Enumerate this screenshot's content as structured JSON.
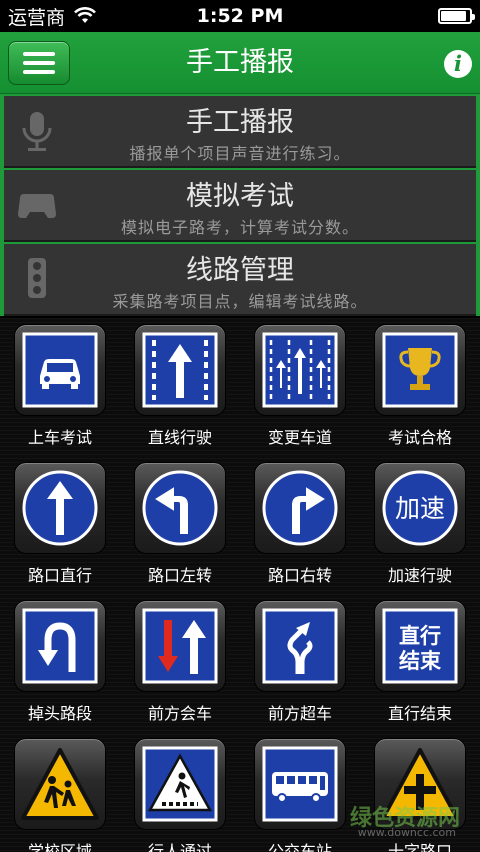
{
  "status": {
    "carrier": "运营商",
    "time": "1:52 PM",
    "battery_percent": 90
  },
  "nav": {
    "title": "手工播报",
    "menu_icon": "hamburger-icon",
    "info_icon": "info-icon"
  },
  "menu": [
    {
      "title": "手工播报",
      "subtitle": "播报单个项目声音进行练习。",
      "icon": "microphone-icon"
    },
    {
      "title": "模拟考试",
      "subtitle": "模拟电子路考，计算考试分数。",
      "icon": "gamepad-icon"
    },
    {
      "title": "线路管理",
      "subtitle": "采集路考项目点，编辑考试线路。",
      "icon": "traffic-light-icon"
    }
  ],
  "items": [
    {
      "label": "上车考试",
      "icon": "car-sign-icon"
    },
    {
      "label": "直线行驶",
      "icon": "straight-lane-sign-icon"
    },
    {
      "label": "变更车道",
      "icon": "lane-change-sign-icon"
    },
    {
      "label": "考试合格",
      "icon": "trophy-sign-icon"
    },
    {
      "label": "路口直行",
      "icon": "straight-arrow-sign-icon"
    },
    {
      "label": "路口左转",
      "icon": "left-turn-sign-icon"
    },
    {
      "label": "路口右转",
      "icon": "right-turn-sign-icon"
    },
    {
      "label": "加速行驶",
      "icon": "accelerate-sign-icon",
      "sign_text": "加速"
    },
    {
      "label": "掉头路段",
      "icon": "u-turn-sign-icon"
    },
    {
      "label": "前方会车",
      "icon": "oncoming-traffic-sign-icon"
    },
    {
      "label": "前方超车",
      "icon": "overtake-sign-icon"
    },
    {
      "label": "直行结束",
      "icon": "straight-end-sign-icon",
      "sign_text_1": "直行",
      "sign_text_2": "结束"
    },
    {
      "label": "学校区域",
      "icon": "school-zone-sign-icon"
    },
    {
      "label": "行人通过",
      "icon": "pedestrian-crossing-sign-icon"
    },
    {
      "label": "公交车站",
      "icon": "bus-stop-sign-icon"
    },
    {
      "label": "十字路口",
      "icon": "crossroad-sign-icon"
    }
  ],
  "watermark": {
    "text": "绿色资源网",
    "url_text": "www.downcc.com"
  },
  "colors": {
    "nav_green": "#1a9a36",
    "sign_blue": "#1e3fa8",
    "warning_yellow": "#f5b800"
  }
}
